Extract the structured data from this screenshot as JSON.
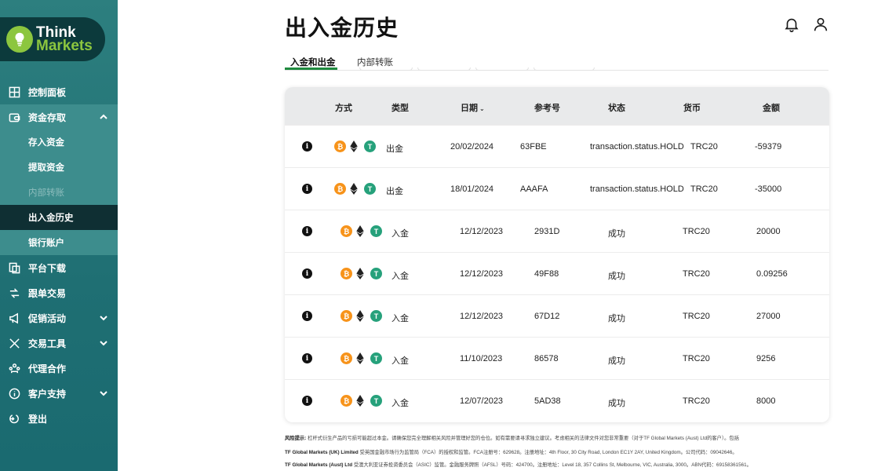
{
  "brand": {
    "line1": "Think",
    "line2": "Markets"
  },
  "sidebar": {
    "items": [
      {
        "label": "控制面板"
      },
      {
        "label": "资金存取"
      },
      {
        "label": "平台下载"
      },
      {
        "label": "跟单交易"
      },
      {
        "label": "促销活动"
      },
      {
        "label": "交易工具"
      },
      {
        "label": "代理合作"
      },
      {
        "label": "客户支持"
      },
      {
        "label": "登出"
      }
    ],
    "sub_items": [
      {
        "label": "存入资金"
      },
      {
        "label": "提取资金"
      },
      {
        "label": "内部转账"
      },
      {
        "label": "出入金历史"
      },
      {
        "label": "银行账户"
      }
    ]
  },
  "page": {
    "title": "出入金历史"
  },
  "tabs": [
    {
      "label": "入金和出金"
    },
    {
      "label": "内部转账"
    }
  ],
  "table": {
    "columns": {
      "method": "方式",
      "type": "类型",
      "date": "日期",
      "date_sort": "⌄",
      "ref": "参考号",
      "status": "状态",
      "currency": "货币",
      "amount": "金额"
    },
    "rows": [
      {
        "type": "出金",
        "date": "20/02/2024",
        "ref": "63FBE",
        "status": "transaction.status.HOLD",
        "currency": "TRC20",
        "amount": "-59379"
      },
      {
        "type": "出金",
        "date": "18/01/2024",
        "ref": "AAAFA",
        "status": "transaction.status.HOLD",
        "currency": "TRC20",
        "amount": "-35000"
      },
      {
        "type": "入金",
        "date": "12/12/2023",
        "ref": "2931D",
        "status": "成功",
        "currency": "TRC20",
        "amount": "20000"
      },
      {
        "type": "入金",
        "date": "12/12/2023",
        "ref": "49F88",
        "status": "成功",
        "currency": "TRC20",
        "amount": "0.09256"
      },
      {
        "type": "入金",
        "date": "12/12/2023",
        "ref": "67D12",
        "status": "成功",
        "currency": "TRC20",
        "amount": "27000"
      },
      {
        "type": "入金",
        "date": "11/10/2023",
        "ref": "86578",
        "status": "成功",
        "currency": "TRC20",
        "amount": "9256"
      },
      {
        "type": "入金",
        "date": "12/07/2023",
        "ref": "5AD38",
        "status": "成功",
        "currency": "TRC20",
        "amount": "8000"
      }
    ]
  },
  "footer": {
    "line1_bold": "风险提示:",
    "line1": "杠杆式衍生产品的亏损可能超过本金。请确保您完全理解相关风险并管理好您的仓位。如有需要请寻求独立建议。考虑相关的法律文件对您非常重要（对于TF Global Markets (Aust) Ltd的客户）。包括",
    "line2_bold": "TF Global Markets (UK) Limited",
    "line2": "受英国金融市场行为监管局（FCA）的授权和监管。FCA注册号：629628。注册地址：4th Floor, 30 City Road, London EC1Y 2AY, United Kingdom。公司代码：09042646。",
    "line3_bold": "TF Global Markets (Aust) Ltd",
    "line3": "受澳大利亚证券投资委员会（ASIC）监管。金融服务牌照（AFSL）号码：424700。注册地址：Level 18, 357 Collins St, Melbourne, VIC, Australia, 3000。ABN代码：69158361561。"
  },
  "colors": {
    "sidebar": "#1f6f73",
    "active_sub": "#0f2f33",
    "accent_green": "#1f8a3f",
    "btc": "#f7931a",
    "usdt": "#26a17b"
  },
  "icons": {
    "notification": "bell-icon",
    "account": "user-icon"
  }
}
